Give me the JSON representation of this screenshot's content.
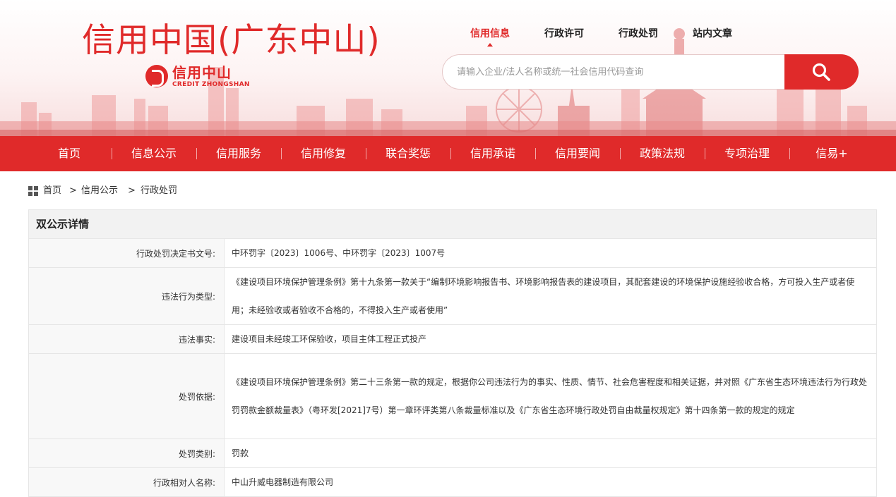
{
  "header": {
    "site_title": "信用中国(广东中山)",
    "logo_cn": "信用中山",
    "logo_en": "CREDIT ZHONGSHAN"
  },
  "top_nav": [
    {
      "label": "信用信息",
      "active": true
    },
    {
      "label": "行政许可",
      "active": false
    },
    {
      "label": "行政处罚",
      "active": false
    },
    {
      "label": "站内文章",
      "active": false
    }
  ],
  "search": {
    "placeholder": "请输入企业/法人名称或统一社会信用代码查询",
    "icon": "search-icon"
  },
  "main_nav": [
    "首页",
    "信息公示",
    "信用服务",
    "信用修复",
    "联合奖惩",
    "信用承诺",
    "信用要闻",
    "政策法规",
    "专项治理",
    "信易+"
  ],
  "breadcrumb": [
    "首页",
    "信用公示",
    "行政处罚"
  ],
  "breadcrumb_sep": ">",
  "panel": {
    "title": "双公示详情",
    "rows": [
      {
        "label": "行政处罚决定书文号:",
        "value": "中环罚字〔2023〕1006号、中环罚字〔2023〕1007号"
      },
      {
        "label": "违法行为类型:",
        "value": "《建设项目环境保护管理条例》第十九条第一款关于“编制环境影响报告书、环境影响报告表的建设项目，其配套建设的环境保护设施经验收合格，方可投入生产或者使用；未经验收或者验收不合格的，不得投入生产或者使用”"
      },
      {
        "label": "违法事实:",
        "value": "建设项目未经竣工环保验收，项目主体工程正式投产"
      },
      {
        "label": "处罚依据:",
        "value": "《建设项目环境保护管理条例》第二十三条第一款的规定，根据你公司违法行为的事实、性质、情节、社会危害程度和相关证据，并对照《广东省生态环境违法行为行政处罚罚款金额裁量表》（粤环发[2021]7号）第一章环评类第八条裁量标准以及《广东省生态环境行政处罚自由裁量权规定》第十四条第一款的规定的规定"
      },
      {
        "label": "处罚类别:",
        "value": "罚款"
      },
      {
        "label": "行政相对人名称:",
        "value": "中山升威电器制造有限公司"
      }
    ]
  },
  "colors": {
    "brand_red": "#e02a2a"
  }
}
